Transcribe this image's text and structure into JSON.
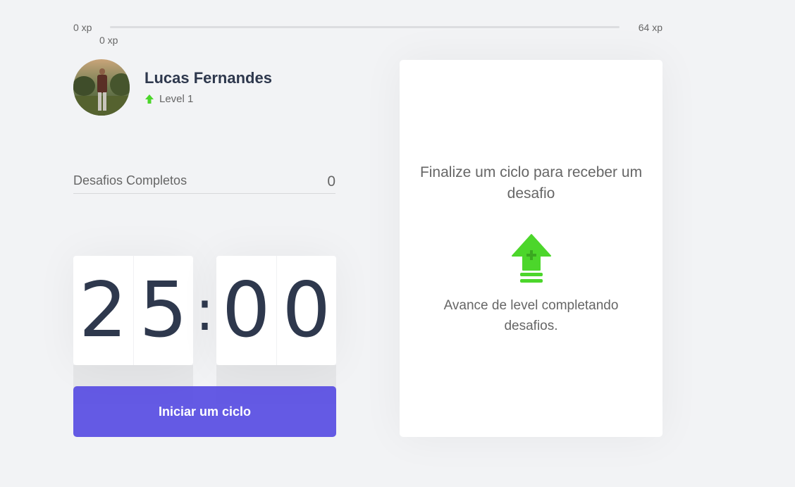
{
  "experience": {
    "min_label": "0 xp",
    "current_label": "0 xp",
    "max_label": "64 xp",
    "progress_percent": 0
  },
  "profile": {
    "name": "Lucas Fernandes",
    "level_label": "Level 1",
    "level_icon": "level-up-arrow-icon"
  },
  "stats": {
    "completed_label": "Desafios Completos",
    "completed_value": "0"
  },
  "countdown": {
    "minute_left": "2",
    "minute_right": "5",
    "separator": ":",
    "second_left": "0",
    "second_right": "0"
  },
  "actions": {
    "start_cycle_label": "Iniciar um ciclo"
  },
  "challenge_box": {
    "title": "Finalize um ciclo para receber um desafio",
    "hint": "Avance de level completando desafios.",
    "icon": "level-up-icon"
  },
  "colors": {
    "background": "#f2f3f5",
    "accent_green": "#4cd62b",
    "button_purple": "#5965e0",
    "title_dark": "#2e384d",
    "text": "#666666"
  }
}
